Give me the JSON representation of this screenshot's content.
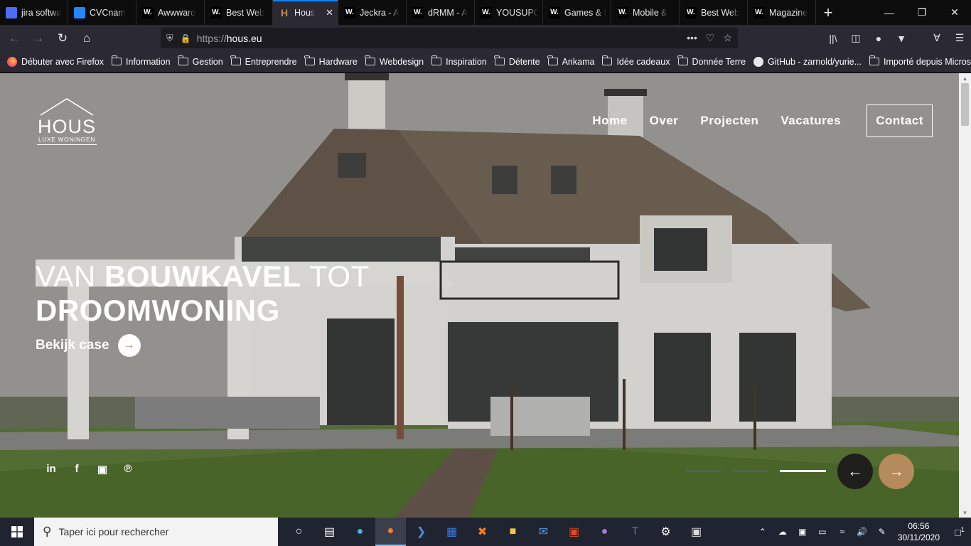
{
  "browser": {
    "tabs": [
      {
        "label": "jira softwa",
        "icon": "jira-icon",
        "color": "#4c6ef5",
        "active": false
      },
      {
        "label": "CVCnam",
        "icon": "jira-diamond-icon",
        "color": "#2684ff",
        "active": false
      },
      {
        "label": "Awwward",
        "icon": "awwwards-icon",
        "color": "#000000",
        "active": false
      },
      {
        "label": "Best Web",
        "icon": "awwwards-icon",
        "color": "#000000",
        "active": false
      },
      {
        "label": "Hous",
        "icon": "hous-icon",
        "color": "#c08a55",
        "active": true
      },
      {
        "label": "Jeckra - A",
        "icon": "awwwards-icon",
        "color": "#000000",
        "active": false
      },
      {
        "label": "dRMM - A",
        "icon": "awwwards-icon",
        "color": "#000000",
        "active": false
      },
      {
        "label": "YOUSUPO",
        "icon": "awwwards-icon",
        "color": "#000000",
        "active": false
      },
      {
        "label": "Games & I",
        "icon": "awwwards-icon",
        "color": "#000000",
        "active": false
      },
      {
        "label": "Mobile &",
        "icon": "awwwards-icon",
        "color": "#000000",
        "active": false
      },
      {
        "label": "Best Web",
        "icon": "awwwards-icon",
        "color": "#000000",
        "active": false
      },
      {
        "label": "Magazine",
        "icon": "awwwards-icon",
        "color": "#000000",
        "active": false
      }
    ],
    "url_protocol": "https://",
    "url_host": "hous.eu",
    "bookmarks": [
      {
        "label": "Débuter avec Firefox",
        "icon": "firefox-icon"
      },
      {
        "label": "Information",
        "icon": "folder-icon"
      },
      {
        "label": "Gestion",
        "icon": "folder-icon"
      },
      {
        "label": "Entreprendre",
        "icon": "folder-icon"
      },
      {
        "label": "Hardware",
        "icon": "folder-icon"
      },
      {
        "label": "Webdesign",
        "icon": "folder-icon"
      },
      {
        "label": "Inspiration",
        "icon": "folder-icon"
      },
      {
        "label": "Détente",
        "icon": "folder-icon"
      },
      {
        "label": "Ankama",
        "icon": "folder-icon"
      },
      {
        "label": "Idée cadeaux",
        "icon": "folder-icon"
      },
      {
        "label": "Donnée Terre",
        "icon": "folder-icon"
      },
      {
        "label": "GitHub - zarnold/yurie...",
        "icon": "github-icon"
      },
      {
        "label": "Importé depuis Micros...",
        "icon": "folder-icon"
      }
    ]
  },
  "site": {
    "logo_word": "HOUS",
    "logo_sub": "LUXE WONINGEN",
    "nav": [
      "Home",
      "Over",
      "Projecten",
      "Vacatures"
    ],
    "contact": "Contact",
    "hero_thin_1": "VAN ",
    "hero_bold_1": "BOUWKAVEL",
    "hero_thin_2": " TOT",
    "hero_bold_2": "DROOMWONING",
    "cta": "Bekijk case",
    "social": [
      "linkedin-icon",
      "facebook-icon",
      "instagram-icon",
      "pinterest-icon"
    ],
    "slider": {
      "count": 3,
      "active": 3
    },
    "accent": "#b58a5d"
  },
  "taskbar": {
    "search_placeholder": "Taper ici pour rechercher",
    "time": "06:56",
    "date": "30/11/2020",
    "notifications": "1"
  }
}
